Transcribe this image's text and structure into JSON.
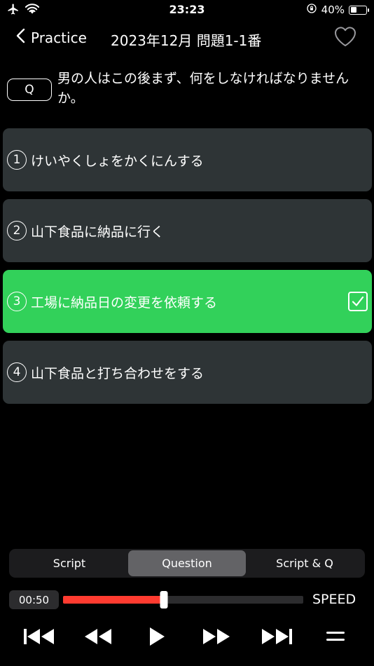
{
  "status_bar": {
    "time": "23:23",
    "battery": "40%",
    "battery_level": 0.4
  },
  "nav": {
    "back_label": "Practice",
    "title": "2023年12月 問題1-1番"
  },
  "question": {
    "badge": "Q",
    "text": "男の人はこの後まず、何をしなければなりませんか。"
  },
  "choices": [
    {
      "number": "1",
      "text": "けいやくしょをかくにんする",
      "selected": false
    },
    {
      "number": "2",
      "text": "山下食品に納品に行く",
      "selected": false
    },
    {
      "number": "3",
      "text": "工場に納品日の変更を依頼する",
      "selected": true
    },
    {
      "number": "4",
      "text": "山下食品と打ち合わせをする",
      "selected": false
    }
  ],
  "tabs": [
    {
      "label": "Script",
      "active": false
    },
    {
      "label": "Question",
      "active": true
    },
    {
      "label": "Script & Q",
      "active": false
    }
  ],
  "player": {
    "elapsed": "00:50",
    "progress": 0.42,
    "speed_label": "SPEED"
  },
  "colors": {
    "correct": "#32d15a",
    "choice_bg": "#2e3436",
    "progress": "#ff3b30"
  }
}
